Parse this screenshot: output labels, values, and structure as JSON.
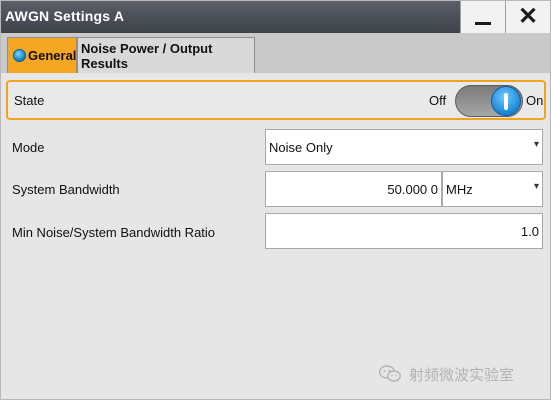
{
  "window": {
    "title": "AWGN Settings A",
    "minimize_icon": "minimize-icon",
    "close_icon": "close-icon",
    "close_glyph": "✕"
  },
  "tabs": [
    {
      "label": "General",
      "active": true,
      "icon": "info-dot-icon"
    },
    {
      "label": "Noise Power / Output Results",
      "active": false
    }
  ],
  "state": {
    "label": "State",
    "off_label": "Off",
    "on_label": "On",
    "value": "On"
  },
  "fields": {
    "mode": {
      "label": "Mode",
      "value": "Noise Only"
    },
    "system_bandwidth": {
      "label": "System Bandwidth",
      "value": "50.000 0",
      "unit": "MHz"
    },
    "ratio": {
      "label": "Min Noise/System Bandwidth Ratio",
      "value": "1.0"
    }
  },
  "watermark": {
    "text": "射频微波实验室",
    "icon": "wechat-icon"
  },
  "colors": {
    "accent_orange": "#f5a623",
    "toggle_blue": "#1b86d6",
    "titlebar": "#4a4e55"
  }
}
